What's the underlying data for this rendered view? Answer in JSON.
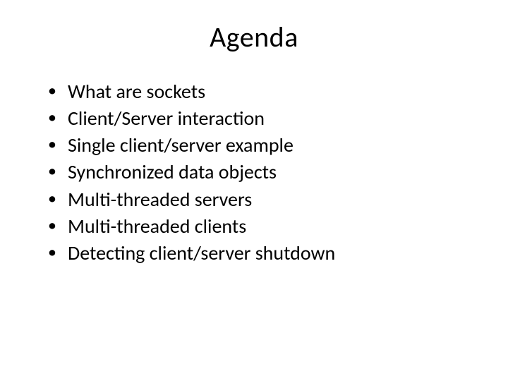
{
  "slide": {
    "title": "Agenda",
    "bullets": [
      "What are sockets",
      "Client/Server interaction",
      "Single client/server example",
      "Synchronized data objects",
      "Multi-threaded servers",
      "Multi-threaded clients",
      "Detecting client/server shutdown"
    ]
  }
}
